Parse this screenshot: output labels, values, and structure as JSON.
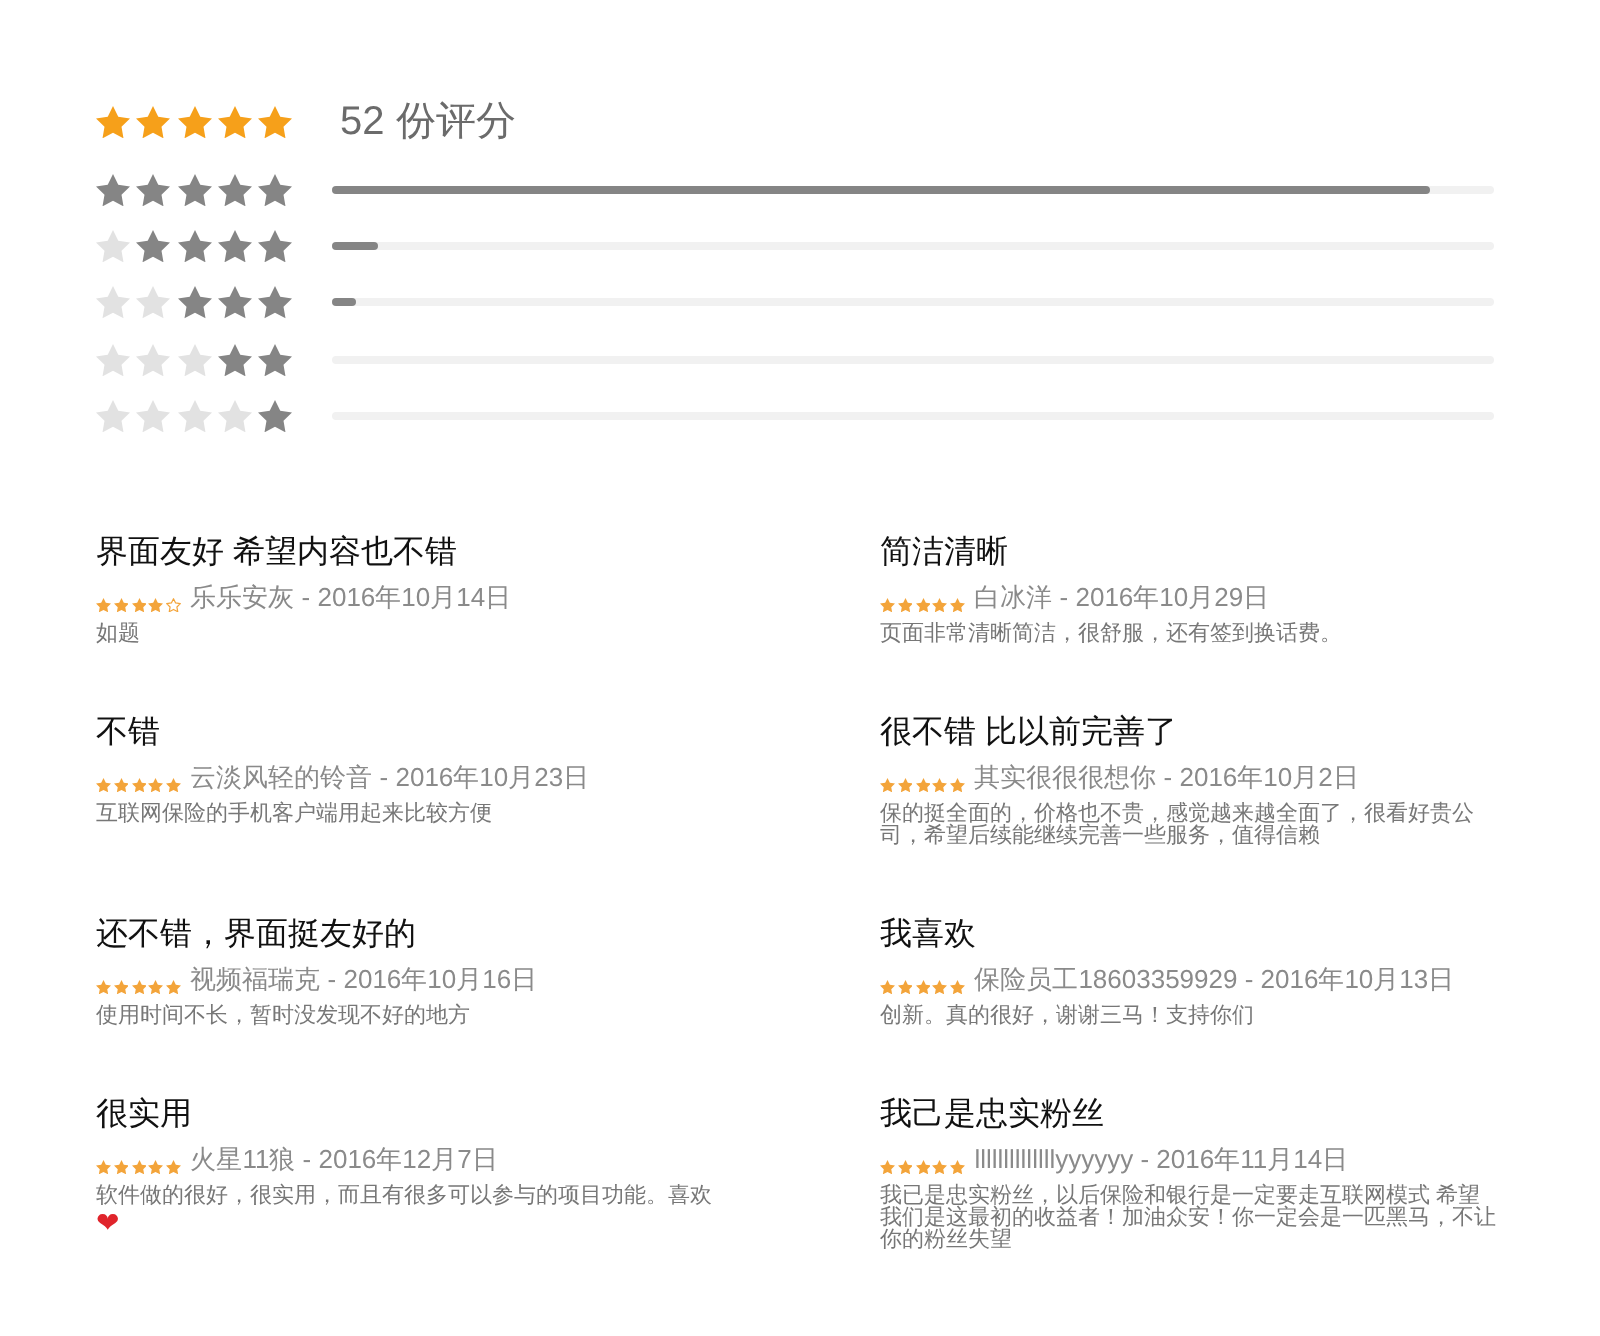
{
  "summary": {
    "stars": 5,
    "count": "52 份评分"
  },
  "histogram": [
    {
      "stars": 5,
      "level": 0.945
    },
    {
      "stars": 4,
      "level": 0.04
    },
    {
      "stars": 3,
      "level": 0.02
    },
    {
      "stars": 2
    },
    {
      "stars": 1
    }
  ],
  "reviews": [
    {
      "title": "界面友好 希望内容也不错",
      "stars": 4,
      "byline": "乐乐安灰 - 2016年10月14日",
      "body": "如题"
    },
    {
      "title": "简洁清晰",
      "stars": 5,
      "byline": "白冰洋 - 2016年10月29日",
      "body": "页面非常清晰简洁，很舒服，还有签到换话费。"
    },
    {
      "title": "不错",
      "stars": 5,
      "byline": "云淡风轻的铃音 - 2016年10月23日",
      "body": "互联网保险的手机客户端用起来比较方便"
    },
    {
      "title": "很不错 比以前完善了",
      "stars": 5,
      "byline": "其实很很很想你 - 2016年10月2日",
      "body": "保的挺全面的，价格也不贵，感觉越来越全面了，很看好贵公司，希望后续能继续完善一些服务，值得信赖"
    },
    {
      "title": "还不错，界面挺友好的",
      "stars": 5,
      "byline": "视频福瑞克 - 2016年10月16日",
      "body": "使用时间不长，暂时没发现不好的地方"
    },
    {
      "title": "我喜欢",
      "stars": 5,
      "byline": "保险员工18603359929 - 2016年10月13日",
      "body": "创新。真的很好，谢谢三马！支持你们"
    },
    {
      "title": "很实用",
      "stars": 5,
      "byline": "火星11狼 - 2016年12月7日",
      "body": "软件做的很好，很实用，而且有很多可以参与的项目功能。喜欢",
      "emoji": "❤"
    },
    {
      "title": "我己是忠实粉丝",
      "stars": 5,
      "byline": "llllllllllllllyyyyyy - 2016年11月14日",
      "body": "我已是忠实粉丝，以后保险和银行是一定要走互联网模式 希望我们是这最初的收益者！加油众安！你一定会是一匹黑马，不让你的粉丝失望"
    }
  ]
}
